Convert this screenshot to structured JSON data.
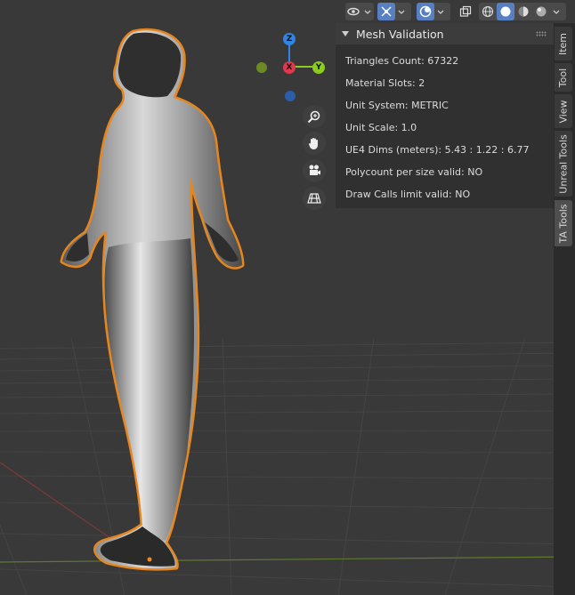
{
  "header": {
    "icons": [
      "eye-icon",
      "gizmo-icon",
      "overlay-icon",
      "xray-icon",
      "wireframe-icon",
      "solid-icon",
      "material-icon",
      "rendered-icon"
    ]
  },
  "gizmo": {
    "axis_labels": {
      "z": "Z",
      "x": "X",
      "y": "Y"
    },
    "colors": {
      "x": "#e0384f",
      "y": "#8ccc1c",
      "z": "#2f85e4",
      "neg_y": "#6b8a22",
      "neg_z": "#2b5ea8"
    }
  },
  "nav_buttons": [
    "zoom-icon",
    "hand-icon",
    "camera-icon",
    "grid-icon"
  ],
  "panel": {
    "title": "Mesh Validation",
    "rows": [
      "Triangles Count: 67322",
      "Material Slots: 2",
      "Unit System: METRIC",
      "Unit Scale: 1.0",
      "UE4 Dims (meters): 5.43 : 1.22 : 6.77",
      "Polycount per size valid: NO",
      "Draw Calls limit valid: NO"
    ]
  },
  "tabs": [
    "Item",
    "Tool",
    "View",
    "Unreal Tools",
    "TA Tools"
  ],
  "active_tab": "TA Tools",
  "colors": {
    "background": "#393939",
    "selection_outline": "#f08a1a",
    "active_button": "#5680c2"
  }
}
